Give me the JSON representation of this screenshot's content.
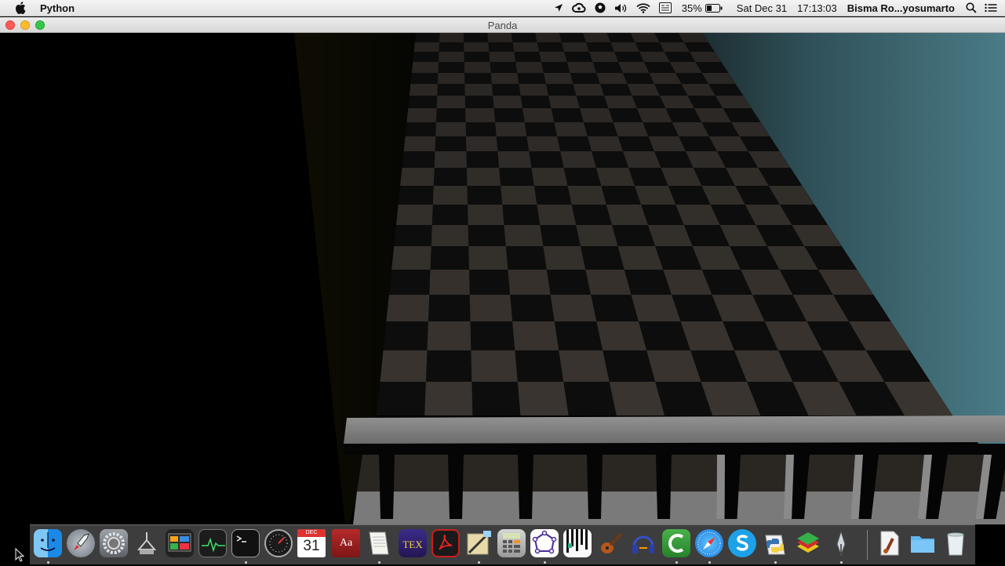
{
  "menubar": {
    "app_name": "Python",
    "battery_percent": "35%",
    "date": "Sat Dec 31",
    "time": "17:13:03",
    "user": "Bisma Ro...yosumarto",
    "icons": [
      "apple-icon",
      "location-arrow-icon",
      "creative-cloud-icon",
      "soccer-ball-icon",
      "volume-icon",
      "wifi-icon",
      "keyboard-input-icon",
      "battery-icon",
      "spotlight-search-icon",
      "notification-center-icon"
    ]
  },
  "window": {
    "title": "Panda"
  },
  "dock": {
    "calendar_month": "DEC",
    "calendar_day": "31",
    "dictionary_glyph": "Aa",
    "tex_glyph": "TEX",
    "items": [
      "Finder",
      "Launchpad",
      "System Preferences",
      "Keychain Access",
      "Mission Control",
      "Activity Monitor",
      "Terminal",
      "Disk Utility",
      "Calendar",
      "Dictionary",
      "TextEdit",
      "TeXShop",
      "Adobe Acrobat",
      "Preview",
      "Calculator",
      "Graph",
      "Piano",
      "GarageBand",
      "Headphones",
      "Camtasia",
      "Safari",
      "Skype",
      "Python Launcher",
      "BlueStacks",
      "Inkscape",
      "Script",
      "Folder",
      "Trash"
    ]
  },
  "scene": {
    "description_colors": {
      "floor_dark": "#0c0c0c",
      "floor_light": "#3a3530",
      "wall_right": "#3f6d77",
      "railing_top": "#8a8a8a"
    }
  }
}
